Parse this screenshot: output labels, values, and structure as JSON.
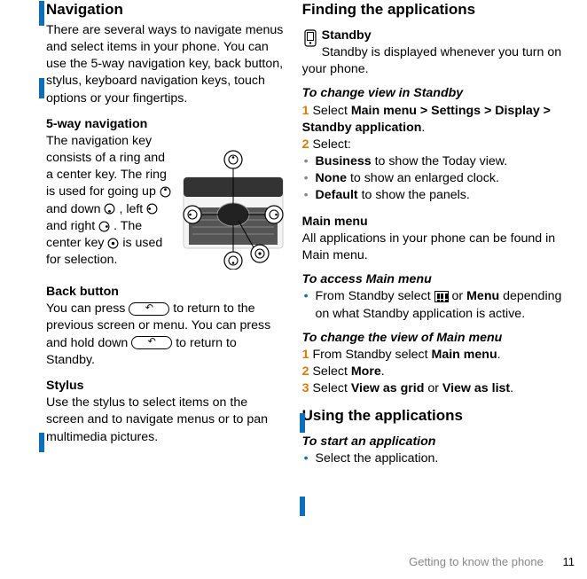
{
  "left": {
    "heading_nav": "Navigation",
    "nav_para1": "There are several ways to navigate menus and select items in your phone. You can use the 5-way navigation key, back button, stylus, keyboard navigation keys, touch options or your fingertips.",
    "heading_5way": "5-way navigation",
    "nav5_text_a": "The navigation key consists of a ring and a center key. The ring is used for going up ",
    "nav5_text_b": " and down ",
    "nav5_text_c": ", left ",
    "nav5_text_d": " and right ",
    "nav5_text_e": ". The center key ",
    "nav5_text_f": " is used for selection.",
    "heading_back": "Back button",
    "back_a": "You can press ",
    "back_b": " to return to the previous screen or menu. You can press and hold down ",
    "back_c": " to return to Standby.",
    "heading_stylus": "Stylus",
    "stylus_para": "Use the stylus to select items on the screen and to navigate menus or to pan multimedia pictures."
  },
  "right": {
    "heading_find": "Finding the applications",
    "standby_label": "Standby",
    "standby_para": "Standby is displayed whenever you turn on your phone.",
    "heading_change_standby": "To change view in Standby",
    "step1_a": "Select ",
    "step1_b": "Main menu > Settings > Display > Standby application",
    "step1_c": ".",
    "step2": "Select:",
    "bullet_biz_a": "Business",
    "bullet_biz_b": " to show the Today view.",
    "bullet_none_a": "None",
    "bullet_none_b": " to show an enlarged clock.",
    "bullet_def_a": "Default",
    "bullet_def_b": " to show the panels.",
    "heading_mainmenu": "Main menu",
    "mainmenu_para": "All applications in your phone can be found in Main menu.",
    "heading_access_main": "To access Main menu",
    "access_a": "From Standby select ",
    "access_b": " or ",
    "access_c": "Menu",
    "access_d": " depending on what Standby application is active.",
    "heading_change_main": "To change the view of Main menu",
    "cm1_a": "From Standby select ",
    "cm1_b": "Main menu",
    "cm1_c": ".",
    "cm2_a": "Select ",
    "cm2_b": "More",
    "cm2_c": ".",
    "cm3_a": "Select ",
    "cm3_b": "View as grid",
    "cm3_c": " or ",
    "cm3_d": "View as list",
    "cm3_e": ".",
    "heading_using": "Using the applications",
    "heading_start": "To start an application",
    "start_bullet": "Select the application."
  },
  "footer": {
    "section": "Getting to know the phone",
    "page": "11"
  },
  "step_labels": {
    "s1": "1",
    "s2": "2",
    "s3": "3"
  }
}
